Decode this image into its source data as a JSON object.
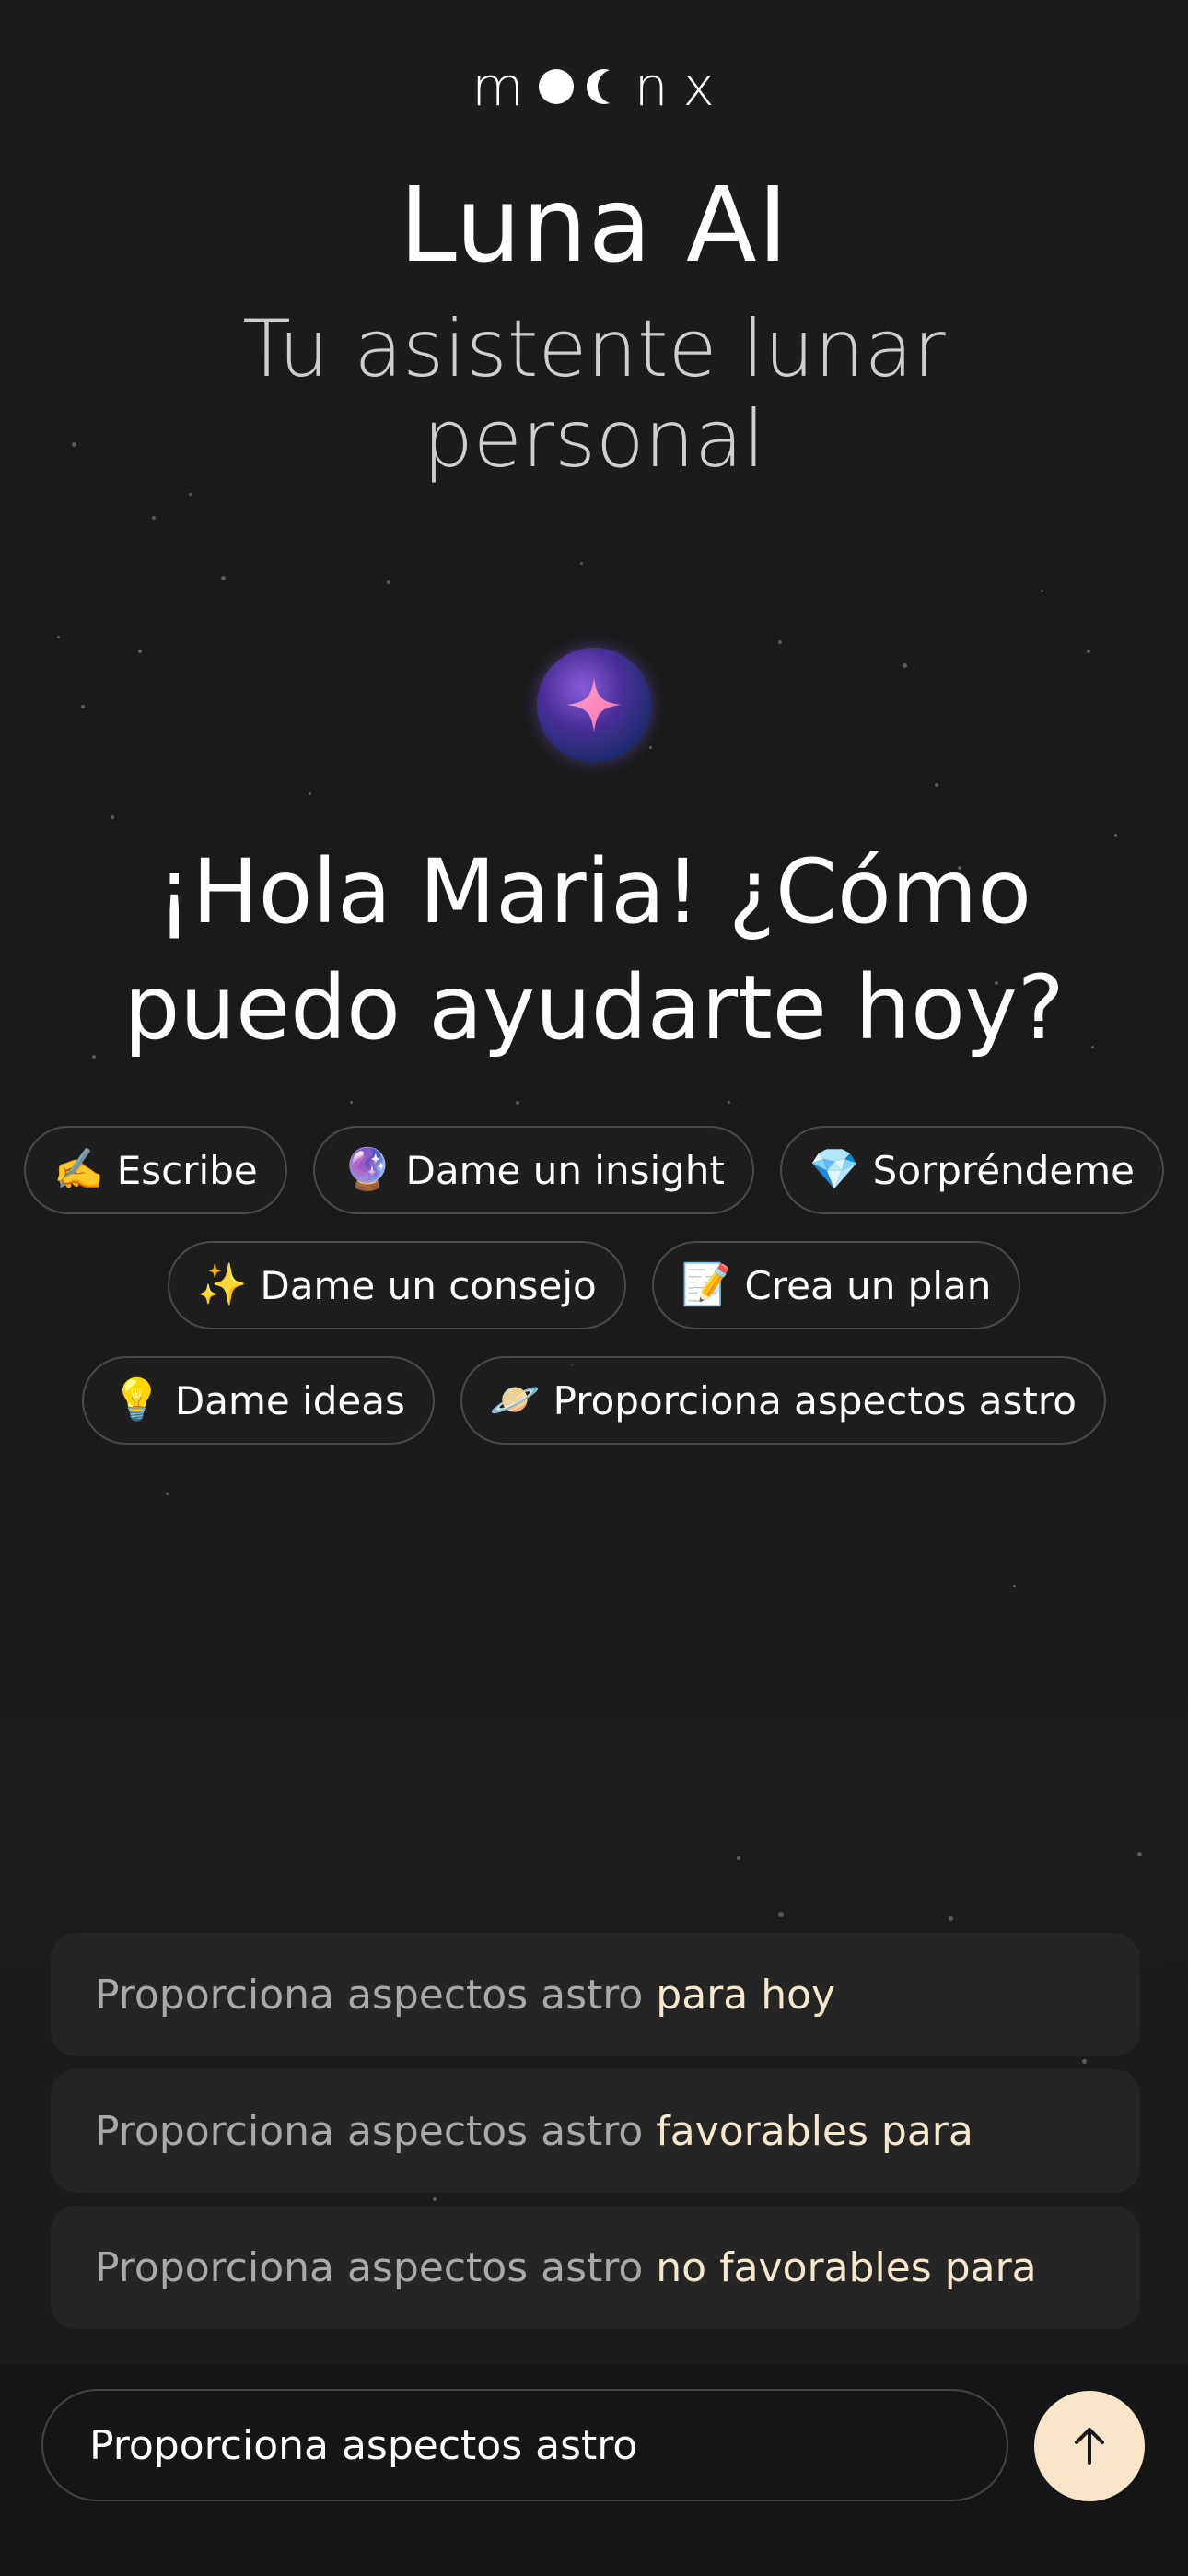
{
  "brand": {
    "logo_letters": [
      "m",
      "n",
      "x"
    ],
    "accent_color": "#f7e5c9"
  },
  "header": {
    "title": "Luna AI",
    "subtitle": "Tu asistente lunar personal"
  },
  "assistant": {
    "avatar_icon": "sparkle-orb-icon",
    "greeting": "¡Hola Maria! ¿Cómo puedo ayudarte hoy?"
  },
  "quick_actions": {
    "row1": [
      {
        "emoji": "✍️",
        "label": "Escribe"
      },
      {
        "emoji": "🔮",
        "label": "Dame un insight"
      },
      {
        "emoji": "💎",
        "label": "Sorpréndeme"
      }
    ],
    "row2": [
      {
        "emoji": "✨",
        "label": "Dame un consejo"
      },
      {
        "emoji": "📝",
        "label": "Crea un plan"
      }
    ],
    "row3": [
      {
        "emoji": "💡",
        "label": "Dame ideas"
      },
      {
        "emoji": "🪐",
        "label": "Proporciona aspectos astro"
      }
    ]
  },
  "suggestions": [
    {
      "base": "Proporciona aspectos astro",
      "highlight": "para hoy"
    },
    {
      "base": "Proporciona aspectos astro",
      "highlight": "favorables para"
    },
    {
      "base": "Proporciona aspectos astro",
      "highlight": "no favorables para"
    }
  ],
  "composer": {
    "value": "Proporciona aspectos astro",
    "send_icon": "arrow-up-icon"
  }
}
